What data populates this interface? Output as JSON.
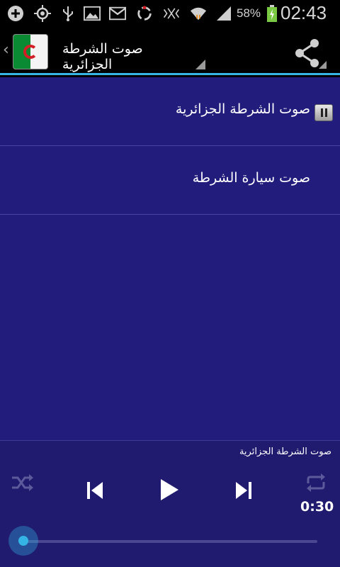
{
  "status_bar": {
    "battery": "58%",
    "time": "02:43",
    "icons": [
      "add-icon",
      "gps-icon",
      "usb-icon",
      "image-icon",
      "gmail-icon",
      "sync-icon",
      "vibrate-icon",
      "wifi-icon",
      "signal-icon",
      "battery-icon"
    ]
  },
  "action_bar": {
    "title": "صوت الشرطة الجزائرية",
    "app_icon_text": "صوت الشرطة الجزائرية",
    "share_icon": "share-icon"
  },
  "list": {
    "items": [
      {
        "label": "صوت الشرطة الجزائرية",
        "playing": true
      },
      {
        "label": "صوت سيارة الشرطة",
        "playing": false
      }
    ]
  },
  "player": {
    "now_playing": "صوت الشرطة الجزائرية",
    "time": "0:30",
    "progress": 0.0
  },
  "colors": {
    "accent": "#34b5e5",
    "list_bg": "#221c7d",
    "player_bg": "#201b6e"
  }
}
